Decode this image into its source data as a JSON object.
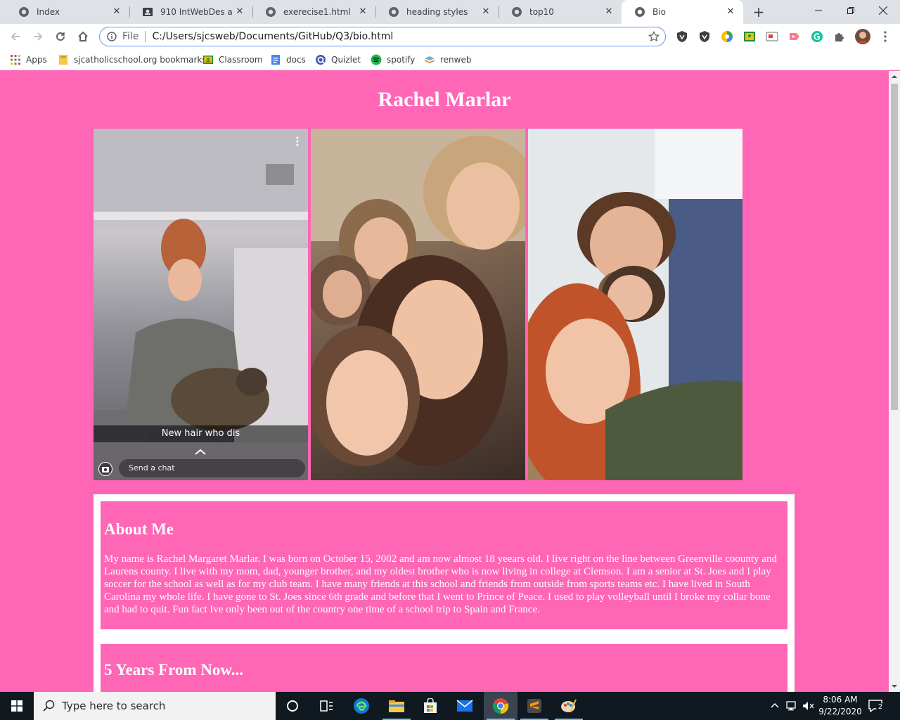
{
  "browser": {
    "tabs": [
      {
        "title": "Index",
        "icon": "globe-icon",
        "active": false
      },
      {
        "title": "910 IntWebDes a",
        "icon": "classroom-icon",
        "active": false
      },
      {
        "title": "exerecise1.html",
        "icon": "globe-icon",
        "active": false
      },
      {
        "title": "heading styles",
        "icon": "globe-icon",
        "active": false
      },
      {
        "title": "top10",
        "icon": "globe-icon",
        "active": false
      },
      {
        "title": "Bio",
        "icon": "globe-icon",
        "active": true
      }
    ],
    "new_tab": "+",
    "address": {
      "scheme_label": "File",
      "url": "C:/Users/sjcsweb/Documents/GitHub/Q3/bio.html"
    },
    "bookmarks": [
      {
        "label": "Apps",
        "icon": "apps-grid-icon"
      },
      {
        "label": "sjcatholicschool.org bookmarks",
        "icon": "folder-icon"
      },
      {
        "label": "Classroom",
        "icon": "classroom-icon"
      },
      {
        "label": "docs",
        "icon": "docs-icon"
      },
      {
        "label": "Quizlet",
        "icon": "quizlet-icon"
      },
      {
        "label": "spotify",
        "icon": "spotify-icon"
      },
      {
        "label": "renweb",
        "icon": "renweb-icon"
      }
    ]
  },
  "page": {
    "heading": "Rachel Marlar",
    "photos": {
      "caption": "New hair who dis",
      "send_chat": "Send a chat"
    },
    "about": {
      "title": "About Me",
      "body": "My name is Rachel Margaret Marlar. I was born on October 15, 2002 and am now almost 18 yeears old. I live right on the line between Greenville coounty and Laurens county. I live with my mom, dad, younger brother, and my oldest brother who is now living in college at Clemson. I am a senior at St. Joes and I play soccer for the school as well as for my club team. I have many friends at this school and friends from outside from sports teams etc. I have lived in South Carolina my whole life. I have gone to St. Joes since 6th grade and before that I went to Prince of Peace. I used to play volleyball until I broke my collar bone and had to quit. Fun fact Ive only been out of the country one time of a school trip to Spain and France."
    },
    "future": {
      "title": "5 Years From Now..."
    }
  },
  "taskbar": {
    "search_placeholder": "Type here to search",
    "time": "8:06 AM",
    "date": "9/22/2020",
    "notification_count": "2"
  },
  "colors": {
    "page_background": "#ff66b5",
    "card_background": "#ffffff",
    "text": "#ffffff"
  }
}
